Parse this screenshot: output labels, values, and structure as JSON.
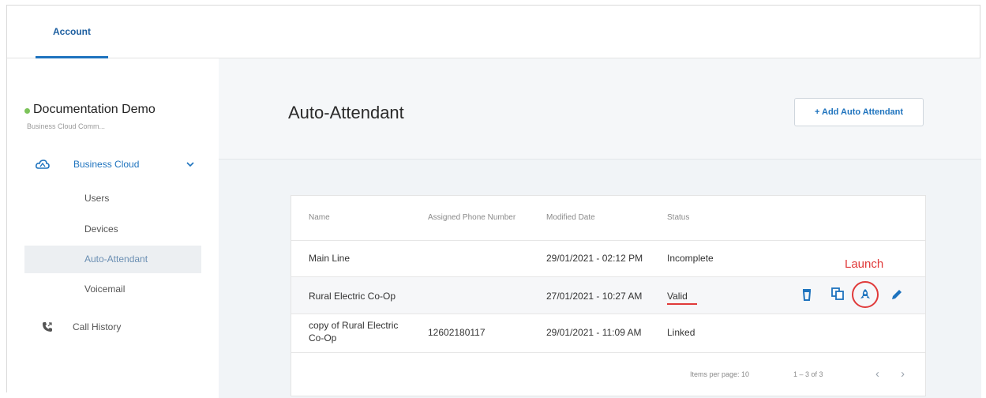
{
  "topbar": {
    "tab_account": "Account"
  },
  "sidebar": {
    "org_name": "Documentation Demo",
    "org_sub": "Business Cloud Comm...",
    "business_cloud": "Business Cloud",
    "items": [
      "Users",
      "Devices",
      "Auto-Attendant",
      "Voicemail"
    ],
    "active_item": "Auto-Attendant",
    "call_history": "Call History"
  },
  "main": {
    "title": "Auto-Attendant",
    "add_button": "+ Add Auto Attendant",
    "table": {
      "headers": [
        "Name",
        "Assigned Phone Number",
        "Modified Date",
        "Status"
      ],
      "rows": [
        {
          "name": "Main Line",
          "phone": "",
          "modified": "29/01/2021 - 02:12 PM",
          "status": "Incomplete"
        },
        {
          "name": "Rural Electric Co-Op",
          "phone": "",
          "modified": "27/01/2021 - 10:27 AM",
          "status": "Valid"
        },
        {
          "name_line1": "copy of Rural Electric",
          "name_line2": "Co-Op",
          "phone": "12602180117",
          "modified": "29/01/2021 - 11:09 AM",
          "status": "Linked"
        }
      ]
    },
    "annotation": "Launch",
    "row_actions": [
      "trash-icon",
      "copy-icon",
      "rocket-icon",
      "pencil-icon"
    ],
    "pagination": {
      "items_per_page_label": "Items per page:",
      "items_per_page": "10",
      "range": "1 – 3 of 3"
    }
  },
  "colors": {
    "accent": "#1e73be",
    "annotation": "#e03a3a",
    "status_dot": "#7cc35a"
  }
}
